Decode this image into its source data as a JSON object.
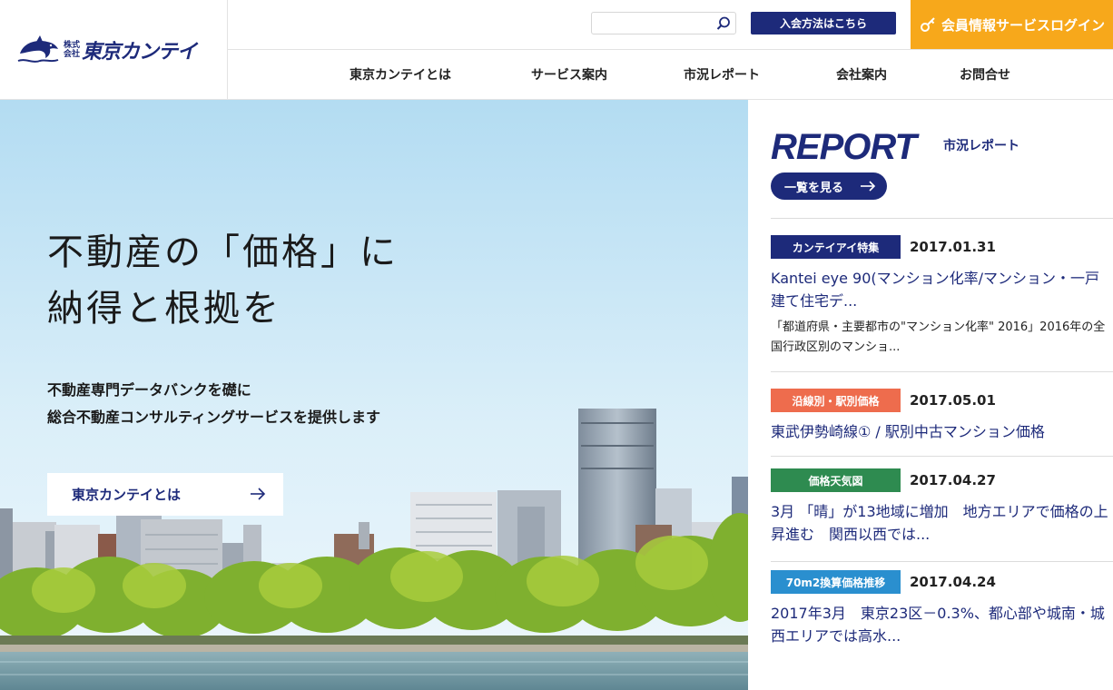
{
  "header": {
    "logo": {
      "small_top": "株式",
      "small_bottom": "会社",
      "name": "東京カンテイ"
    },
    "search": {
      "value": "",
      "placeholder": ""
    },
    "join_label": "入会方法はこちら",
    "login_label": "会員情報サービスログイン",
    "nav": [
      "東京カンテイとは",
      "サービス案内",
      "市況レポート",
      "会社案内",
      "お問合せ"
    ]
  },
  "hero": {
    "title_lines": [
      "不動産の「価格」に",
      "納得と根拠を"
    ],
    "sub_lines": [
      "不動産専門データバンクを礎に",
      "総合不動産コンサルティングサービスを提供します"
    ],
    "button_label": "東京カンテイとは"
  },
  "report": {
    "heading": "REPORT",
    "subheading": "市況レポート",
    "view_all_label": "一覧を見る",
    "entries": [
      {
        "category": "カンテイアイ特集",
        "category_color": "#1d2a7a",
        "date": "2017.01.31",
        "title": "Kantei eye 90(マンション化率/マンション・一戸建て住宅デ...",
        "description": "「都道府県・主要都市の\"マンション化率\" 2016」2016年の全国行政区別のマンショ..."
      },
      {
        "category": "沿線別・駅別価格",
        "category_color": "#ee6c4d",
        "date": "2017.05.01",
        "title": "東武伊勢崎線① / 駅別中古マンション価格",
        "description": ""
      },
      {
        "category": "価格天気図",
        "category_color": "#2e8b50",
        "date": "2017.04.27",
        "title": "3月 「晴」が13地域に増加　地方エリアで価格の上昇進む　関西以西では...",
        "description": ""
      },
      {
        "category": "70m2換算価格推移",
        "category_color": "#2a8fcf",
        "date": "2017.04.24",
        "title": "2017年3月　東京23区－0.3%、都心部や城南・城西エリアでは高水...",
        "description": ""
      }
    ]
  },
  "colors": {
    "brand_navy": "#1d2a7a",
    "login_orange": "#f7a81b"
  }
}
